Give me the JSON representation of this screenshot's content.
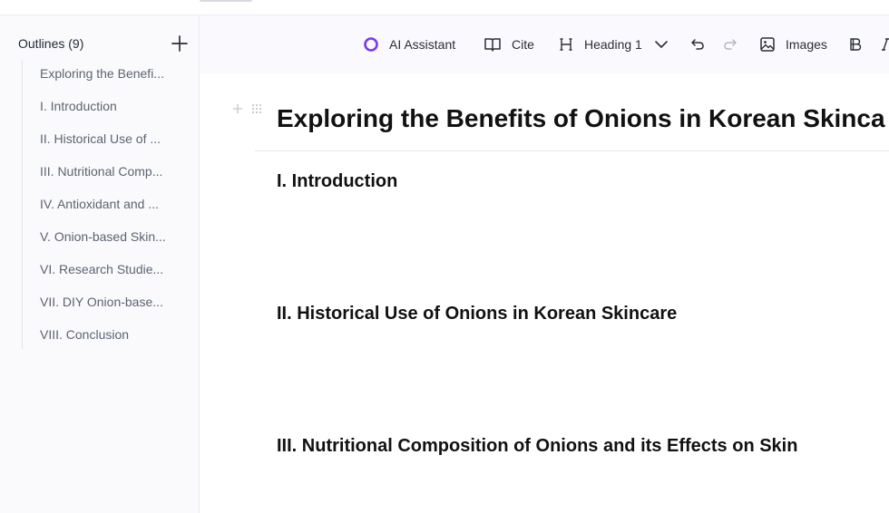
{
  "outline": {
    "title": "Outlines (9)",
    "items": [
      {
        "label": "Exploring the Benefi..."
      },
      {
        "label": "I. Introduction"
      },
      {
        "label": "II. Historical Use of ..."
      },
      {
        "label": "III. Nutritional Comp..."
      },
      {
        "label": "IV. Antioxidant and ..."
      },
      {
        "label": "V. Onion-based Skin..."
      },
      {
        "label": "VI. Research Studie..."
      },
      {
        "label": "VII. DIY Onion-base..."
      },
      {
        "label": "VIII. Conclusion"
      }
    ]
  },
  "toolbar": {
    "ai_label": "AI Assistant",
    "cite_label": "Cite",
    "heading_label": "Heading 1",
    "images_label": "Images"
  },
  "document": {
    "title": "Exploring the Benefits of Onions in Korean Skinca",
    "sections": [
      {
        "heading": "I. Introduction"
      },
      {
        "heading": "II. Historical Use of Onions in Korean Skincare"
      },
      {
        "heading": "III. Nutritional Composition of Onions and its Effects on Skin"
      }
    ]
  },
  "colors": {
    "accent": "#7c3aed",
    "sidebar_bg": "#fafafc",
    "toolbar_bg": "#faf9fe"
  },
  "icons": {
    "ai": "ring-icon",
    "cite": "book-icon",
    "heading": "heading-icon",
    "undo": "undo-icon",
    "redo": "redo-icon",
    "images": "image-icon",
    "bold": "bold-icon",
    "italic": "italic-icon",
    "add": "plus-icon",
    "drag": "drag-handle-icon"
  }
}
